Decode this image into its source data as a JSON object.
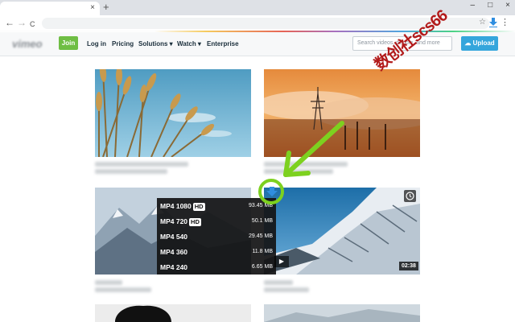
{
  "browser": {
    "tab_close": "×",
    "new_tab": "+",
    "window_controls": [
      "–",
      "□",
      "×"
    ],
    "nav": {
      "back": "←",
      "forward": "→",
      "reload": "C"
    },
    "star": "☆",
    "menu": "⋮"
  },
  "header": {
    "logo": "vimeo",
    "join_label": "Join",
    "nav_links": [
      "Log in",
      "Pricing",
      "Solutions",
      "Watch",
      "Enterprise"
    ],
    "search_placeholder": "Search videos, people, and more",
    "upload_label": "Upload",
    "upload_icon": "cloud-upload-icon"
  },
  "watermark": "数创社scs66",
  "download_menu": {
    "options": [
      {
        "label": "MP4 1080",
        "hd": "HD",
        "size": "93.45 MB"
      },
      {
        "label": "MP4 720",
        "hd": "HD",
        "size": "50.1 MB"
      },
      {
        "label": "MP4 540",
        "hd": "",
        "size": "29.45 MB"
      },
      {
        "label": "MP4 360",
        "hd": "",
        "size": "11.8 MB"
      },
      {
        "label": "MP4 240",
        "hd": "",
        "size": "6.65 MB"
      }
    ]
  },
  "video": {
    "duration": "02:38",
    "play_icon": "▶"
  },
  "colors": {
    "join": "#6fbe44",
    "upload": "#35a6dc",
    "arrow": "#7dd11f",
    "download_icon": "#2f8ee0"
  }
}
